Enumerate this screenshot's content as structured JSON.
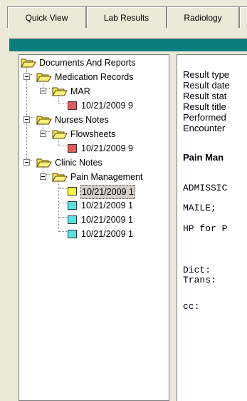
{
  "tabs": [
    {
      "label": "Quick View"
    },
    {
      "label": "Lab Results"
    },
    {
      "label": "Radiology"
    },
    {
      "label": ""
    }
  ],
  "tree": {
    "root": {
      "label": "Documents And Reports"
    },
    "medication_records": {
      "label": "Medication Records"
    },
    "mar": {
      "label": "MAR"
    },
    "mar_doc": {
      "label": "10/21/2009 9",
      "icon": "red-document-icon"
    },
    "nurses_notes": {
      "label": "Nurses Notes"
    },
    "flowsheets": {
      "label": "Flowsheets"
    },
    "flowsheet_doc": {
      "label": "10/21/2009 9",
      "icon": "red-document-icon"
    },
    "clinic_notes": {
      "label": "Clinic Notes"
    },
    "pain_management": {
      "label": "Pain Management"
    },
    "pain_docs": [
      {
        "label": "10/21/2009 1",
        "icon": "yellow-document-icon",
        "selected": true
      },
      {
        "label": "10/21/2009 1",
        "icon": "cyan-document-icon",
        "selected": false
      },
      {
        "label": "10/21/2009 1",
        "icon": "cyan-document-icon",
        "selected": false
      },
      {
        "label": "10/21/2009 1",
        "icon": "cyan-document-icon",
        "selected": false
      }
    ]
  },
  "result": {
    "meta": [
      {
        "text": "Result type"
      },
      {
        "text": "Result date"
      },
      {
        "text": "Result stat"
      },
      {
        "text": "Result title"
      },
      {
        "text": "Performed"
      },
      {
        "text": "Encounter"
      }
    ],
    "title": "Pain Man",
    "body": [
      {
        "text": "ADMISSIC"
      },
      {
        "text": "MAILE;"
      },
      {
        "text": "HP for P"
      },
      {
        "text": "Dict:"
      },
      {
        "text": "Trans:"
      },
      {
        "text": "cc:"
      }
    ]
  },
  "colors": {
    "teal_bar": "#0b7d7d",
    "folder": "#f2e65a",
    "red_doc": "#e04a4a",
    "yellow_doc": "#ffff33",
    "cyan_doc": "#55e3e3"
  }
}
